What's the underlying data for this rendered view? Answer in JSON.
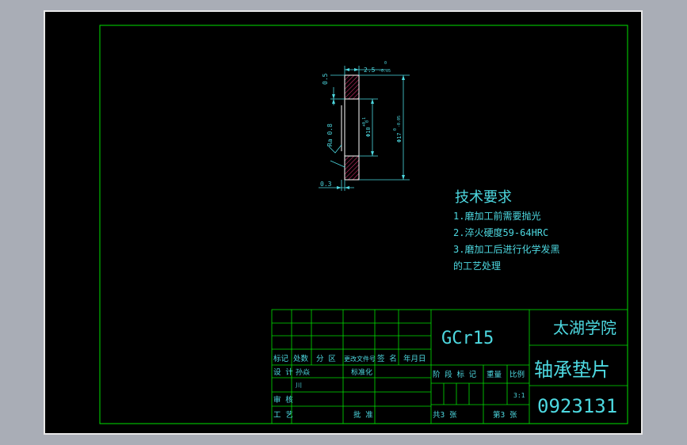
{
  "tech_requirements": {
    "title": "技术要求",
    "items": [
      "1.磨加工前需要抛光",
      "2.淬火硬度59-64HRC",
      "3.磨加工后进行化学发黑",
      "的工艺处理"
    ]
  },
  "dimensions": {
    "top_width": "2.5",
    "top_tol_upper": "0",
    "top_tol_lower": "-0.05",
    "chamfer": "0.5",
    "inner_dia": "Φ10",
    "inner_tol_upper": "+0.1",
    "inner_tol_lower": "0",
    "outer_dia": "Φ17",
    "outer_tol_upper": "0",
    "outer_tol_lower": "-0.05",
    "roughness": "Ra 0.8",
    "bottom_dim": "0.3"
  },
  "title_block": {
    "material": "GCr15",
    "school": "太湖学院",
    "part_name": "轴承垫片",
    "drawing_no": "0923131",
    "scale_value": "3:1",
    "headers": [
      "标记",
      "处数",
      "分 区",
      "更改文件号",
      "签 名",
      "年月日"
    ],
    "row_design": "设 计",
    "designer": "孙焱",
    "standardize": "标准化",
    "designer_extra": "川",
    "row_review": "审 核",
    "row_process": "工 艺",
    "approve": "批 准",
    "stage_mark": "阶 段 标 记",
    "weight": "重量",
    "scale_label": "比例",
    "total_sheets": "共3 张",
    "sheet_no": "第3 张"
  },
  "colors": {
    "frame": "#00e000",
    "text": "#4dd8e0",
    "part": "#ffffff",
    "hatch": "#d0306a",
    "background": "#000000"
  }
}
